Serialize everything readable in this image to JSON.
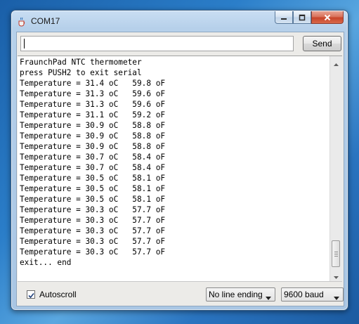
{
  "window": {
    "title": "COM17"
  },
  "toolbar": {
    "input_value": "",
    "send_label": "Send"
  },
  "output": {
    "lines": [
      "FraunchPad NTC thermometer",
      "press PUSH2 to exit serial",
      "Temperature = 31.4 oC   59.8 oF",
      "Temperature = 31.3 oC   59.6 oF",
      "Temperature = 31.3 oC   59.6 oF",
      "Temperature = 31.1 oC   59.2 oF",
      "Temperature = 30.9 oC   58.8 oF",
      "Temperature = 30.9 oC   58.8 oF",
      "Temperature = 30.9 oC   58.8 oF",
      "Temperature = 30.7 oC   58.4 oF",
      "Temperature = 30.7 oC   58.4 oF",
      "Temperature = 30.5 oC   58.1 oF",
      "Temperature = 30.5 oC   58.1 oF",
      "Temperature = 30.5 oC   58.1 oF",
      "Temperature = 30.3 oC   57.7 oF",
      "Temperature = 30.3 oC   57.7 oF",
      "Temperature = 30.3 oC   57.7 oF",
      "Temperature = 30.3 oC   57.7 oF",
      "Temperature = 30.3 oC   57.7 oF",
      "exit... end"
    ]
  },
  "footer": {
    "autoscroll_label": "Autoscroll",
    "autoscroll_checked": true,
    "line_ending": "No line ending",
    "baud_rate": "9600 baud"
  },
  "icons": {
    "app": "java-cup-icon",
    "minimize": "minimize-icon",
    "maximize": "maximize-icon",
    "close": "close-icon",
    "scroll_up": "arrow-up-icon",
    "scroll_down": "arrow-down-icon",
    "checkbox": "checkmark-icon",
    "dropdown": "chevron-down-icon"
  },
  "colors": {
    "close_button": "#c8452a",
    "title_bar": "#b6d0ea",
    "client_bg": "#ecebe8"
  }
}
